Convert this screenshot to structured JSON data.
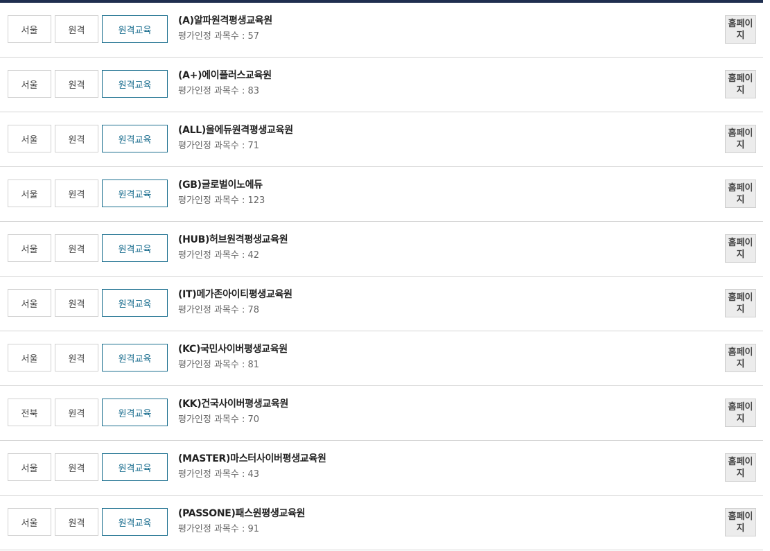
{
  "home_label": "홈페이지",
  "count_label": "평가인정 과목수 : ",
  "institutions": [
    {
      "region": "서울",
      "type": "원격",
      "category": "원격교육",
      "name": "(A)알파원격평생교육원",
      "course_count": "57"
    },
    {
      "region": "서울",
      "type": "원격",
      "category": "원격교육",
      "name": "(A+)에이플러스교육원",
      "course_count": "83"
    },
    {
      "region": "서울",
      "type": "원격",
      "category": "원격교육",
      "name": "(ALL)올에듀원격평생교육원",
      "course_count": "71"
    },
    {
      "region": "서울",
      "type": "원격",
      "category": "원격교육",
      "name": "(GB)글로벌이노에듀",
      "course_count": "123"
    },
    {
      "region": "서울",
      "type": "원격",
      "category": "원격교육",
      "name": "(HUB)허브원격평생교육원",
      "course_count": "42"
    },
    {
      "region": "서울",
      "type": "원격",
      "category": "원격교육",
      "name": "(IT)메가존아이티평생교육원",
      "course_count": "78"
    },
    {
      "region": "서울",
      "type": "원격",
      "category": "원격교육",
      "name": "(KC)국민사이버평생교육원",
      "course_count": "81"
    },
    {
      "region": "전북",
      "type": "원격",
      "category": "원격교육",
      "name": "(KK)건국사이버평생교육원",
      "course_count": "70"
    },
    {
      "region": "서울",
      "type": "원격",
      "category": "원격교육",
      "name": "(MASTER)마스터사이버평생교육원",
      "course_count": "43"
    },
    {
      "region": "서울",
      "type": "원격",
      "category": "원격교육",
      "name": "(PASSONE)패스원평생교육원",
      "course_count": "91"
    }
  ]
}
